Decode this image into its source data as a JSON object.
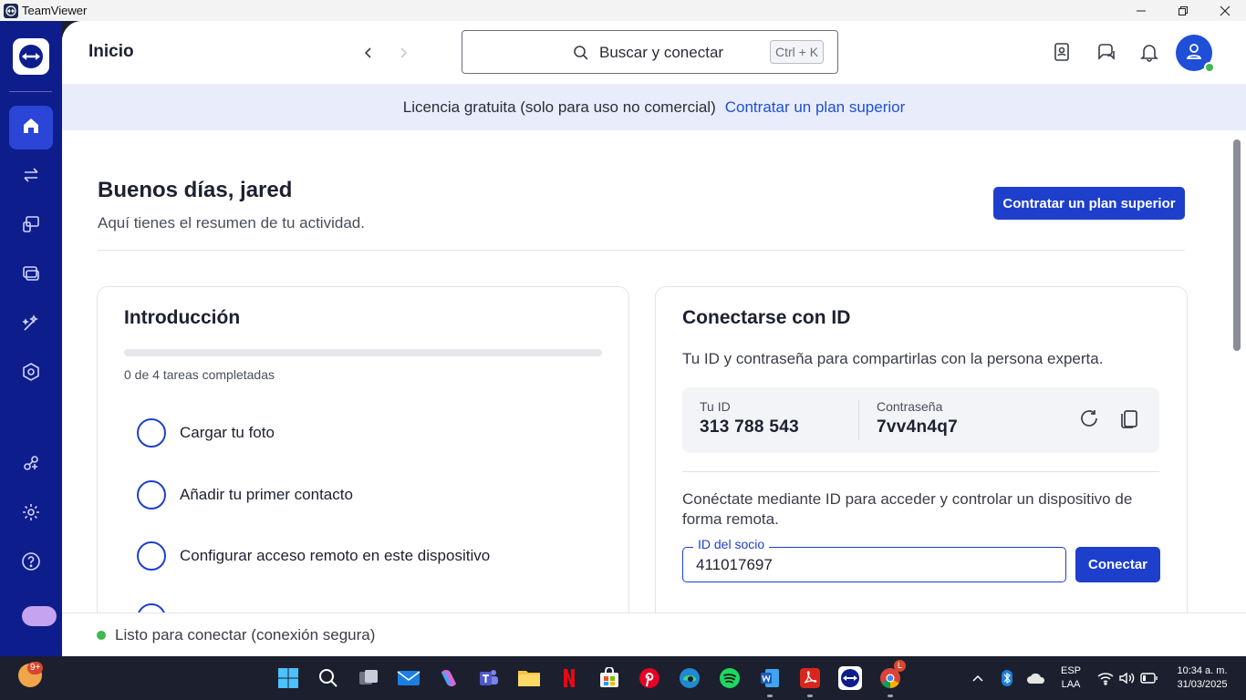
{
  "window": {
    "title": "TeamViewer"
  },
  "header": {
    "page_title": "Inicio",
    "search_placeholder": "Buscar y conectar",
    "search_shortcut": "Ctrl + K"
  },
  "license": {
    "text": "Licencia gratuita (solo para uso no comercial)",
    "link": "Contratar un plan superior"
  },
  "greeting": {
    "title": "Buenos días, jared",
    "subtitle": "Aquí tienes el resumen de tu actividad.",
    "upgrade_button": "Contratar un plan superior"
  },
  "intro": {
    "title": "Introducción",
    "progress_fraction": 0,
    "progress_text": "0 de 4 tareas completadas",
    "tasks": [
      {
        "label": "Cargar tu foto"
      },
      {
        "label": "Añadir tu primer contacto"
      },
      {
        "label": "Configurar acceso remoto en este dispositivo"
      }
    ]
  },
  "connect": {
    "title": "Conectarse con ID",
    "description": "Tu ID y contraseña para compartirlas con la persona experta.",
    "id_label": "Tu ID",
    "id_value": "313 788 543",
    "password_label": "Contraseña",
    "password_value": "7vv4n4q7",
    "remote_description": "Conéctate mediante ID para acceder y controlar un dispositivo de forma remota.",
    "partner_label": "ID del socio",
    "partner_value": "411017697",
    "connect_button": "Conectar"
  },
  "status": {
    "text": "Listo para conectar (conexión segura)",
    "color": "#3fb950"
  },
  "colors": {
    "nav_bg": "#0e1d8c",
    "accent": "#1e3fcc",
    "license_bg": "#e9edfb"
  },
  "taskbar": {
    "weather_badge": "9+",
    "chrome_badge": "L",
    "lang_top": "ESP",
    "lang_bottom": "LAA",
    "time": "10:34 a. m.",
    "date": "31/03/2025"
  }
}
